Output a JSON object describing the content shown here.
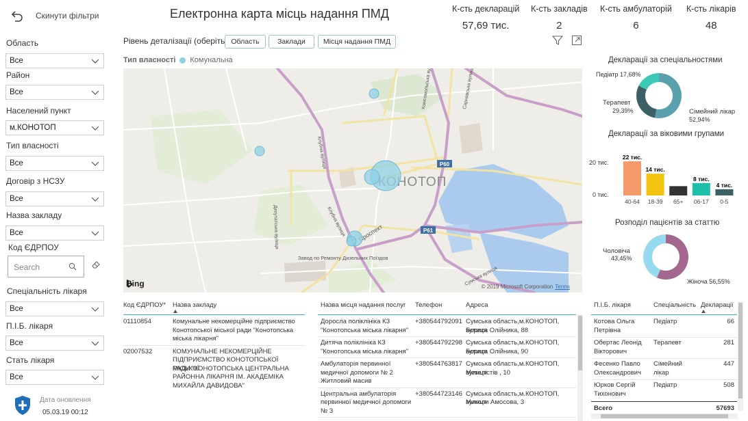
{
  "header": {
    "title": "Електронна карта місць надання ПМД",
    "reset_label": "Скинути фільтри"
  },
  "kpis": [
    {
      "label": "К-сть декларацій",
      "value": "57,69 тис."
    },
    {
      "label": "К-сть закладів",
      "value": "2"
    },
    {
      "label": "К-сть амбулаторій",
      "value": "6"
    },
    {
      "label": "К-сть лікарів",
      "value": "48"
    }
  ],
  "filters": {
    "oblast": {
      "label": "Область",
      "value": "Все"
    },
    "raion": {
      "label": "Район",
      "value": "Все"
    },
    "settlement": {
      "label": "Населений пункт",
      "value": "м.КОНОТОП"
    },
    "ownership": {
      "label": "Тип власності",
      "value": "Все"
    },
    "contract": {
      "label": "Договір з НСЗУ",
      "value": "Все"
    },
    "facility": {
      "label": "Назва закладу",
      "value": "Все"
    },
    "edrpou": {
      "label": "Код ЄДРПОУ",
      "placeholder": "Search"
    },
    "specialty": {
      "label": "Спеціальність лікаря",
      "value": "Все"
    },
    "doctor": {
      "label": "П.І.Б. лікаря",
      "value": "Все"
    },
    "gender": {
      "label": "Стать лікаря",
      "value": "Все"
    }
  },
  "update": {
    "label": "Дата оновлення",
    "value": "05.03.19 00:12"
  },
  "detail": {
    "label": "Рівень деталізації (оберіть)",
    "buttons": [
      "Область",
      "Заклади",
      "Місця надання ПМД"
    ]
  },
  "map": {
    "legend_title": "Тип власності",
    "legend_value": "Комунальна",
    "legend_color": "#8fd0e4",
    "city_label": "КОНОТОП",
    "road_labels": [
      "Р60",
      "Р61"
    ],
    "street_labels": [
      "Клубна вулиця",
      "Депутатська вулиця",
      "Клубна вулиця",
      "Проспект",
      "Сумська вулиця",
      "Комсомольська вулиця",
      "Сарнавська вулиця"
    ],
    "area_labels": [
      "Завод по Ремонту Дизельних Поїздов"
    ],
    "bing_label": "Bing",
    "copyright": "© 2019 Microsoft Corporation",
    "terms": "Terms"
  },
  "charts": {
    "specialty": {
      "title": "Декларації за спеціальностями",
      "labels": [
        "Педіатр 17,68%",
        "Терапевт",
        "29,39%",
        "Сімейний лікар",
        "52,94%"
      ]
    },
    "age": {
      "title": "Декларації за віковими групами",
      "tick_labels": [
        "20 тис.",
        "0 тис."
      ],
      "data_labels": [
        "22 тис.",
        "14 тис.",
        "",
        "8 тис.",
        "4 тис."
      ]
    },
    "gender": {
      "title": "Розподіл пацієнтів за статтю",
      "labels": [
        "Чоловіча",
        "43,45%",
        "Жіноча 56,55%"
      ]
    }
  },
  "chart_data": [
    {
      "type": "pie",
      "title": "Декларації за спеціальностями",
      "categories": [
        "Сімейний лікар",
        "Терапевт",
        "Педіатр"
      ],
      "values": [
        52.94,
        29.39,
        17.68
      ],
      "colors": [
        "#5aa0ad",
        "#3d5f66",
        "#3cc8b4"
      ]
    },
    {
      "type": "bar",
      "title": "Декларації за віковими групами",
      "categories": [
        "40-64",
        "18-39",
        "65+",
        "06-17",
        "0-5"
      ],
      "values": [
        22,
        14,
        6,
        8,
        4
      ],
      "unit": "тис.",
      "ylim": [
        0,
        25
      ],
      "colors": [
        "#f59b6b",
        "#f2c40f",
        "#333333",
        "#1dbfa8",
        "#3d5f66"
      ]
    },
    {
      "type": "pie",
      "title": "Розподіл пацієнтів за статтю",
      "categories": [
        "Жіноча",
        "Чоловіча"
      ],
      "values": [
        56.55,
        43.45
      ],
      "colors": [
        "#a4678e",
        "#97d9ee"
      ]
    }
  ],
  "table_facilities": {
    "headers": [
      "Код ЄДРПОУ*",
      "Назва закладу"
    ],
    "rows": [
      [
        "01110854",
        [
          "Комунальне некомерційне підприємство",
          "Конотопської міської ради \"Конотопська",
          "міська лікарня\""
        ]
      ],
      [
        "02007532",
        [
          "КОМУНАЛЬНЕ НЕКОМЕРЦІЙНЕ",
          "ПІДПРИЄМСТВО КОНОТОПСЬКОЇ МІСЬКОЇ",
          "РАДИ \"КОНОТОПСЬКА ЦЕНТРАЛЬНА",
          "РАЙОННА ЛІКАРНЯ ІМ. АКАДЕМІКА",
          "МИХАЙЛА ДАВИДОВА\""
        ]
      ]
    ]
  },
  "table_places": {
    "headers": [
      "Назва місця надання послуг",
      "Телефон",
      "Адреса"
    ],
    "rows": [
      [
        [
          "Доросла поліклініка КЗ",
          "\"Конотопська міська лікарня\""
        ],
        "+380544792091",
        [
          "Сумська область,м.КОНОТОП, вулиця",
          "Бориса Олійника, 88"
        ]
      ],
      [
        [
          "Дитяча поліклініка КЗ",
          "\"Конотопська міська лікарня\""
        ],
        "+380544792298",
        [
          "Сумська область,м.КОНОТОП, вулиця",
          "Бориса Олійника, 90"
        ]
      ],
      [
        [
          "Амбулаторія первинної",
          "медичної допомоги № 2",
          "Житловий масив"
        ],
        "+380544763817",
        [
          "Сумська область,м.КОНОТОП, вулиця",
          "Металістів , 10"
        ]
      ],
      [
        [
          "Центральна амбулаторія",
          "первинної медичної допомоги",
          "№ 3"
        ],
        "+380544723146",
        [
          "Сумська область,м.КОНОТОП, вулиця",
          "Миколи Амосова, 3"
        ]
      ]
    ]
  },
  "table_doctors": {
    "headers": [
      "П.І.Б. лікаря",
      "Спеціальність",
      "Декларації"
    ],
    "rows": [
      [
        [
          "Котова Ольга",
          "Петрівна"
        ],
        [
          "Педіатр"
        ],
        "66"
      ],
      [
        [
          "Обертас Леонід",
          "Вікторович"
        ],
        [
          "Терапевт"
        ],
        "281"
      ],
      [
        [
          "Фесенко Павло",
          "Олександрович"
        ],
        [
          "Сімейний",
          "лікар"
        ],
        "447"
      ],
      [
        [
          "Юрков Сергій",
          "Тихонович"
        ],
        [
          "Педіатр"
        ],
        "508"
      ]
    ],
    "total_label": "Всего",
    "total_value": "57693"
  }
}
